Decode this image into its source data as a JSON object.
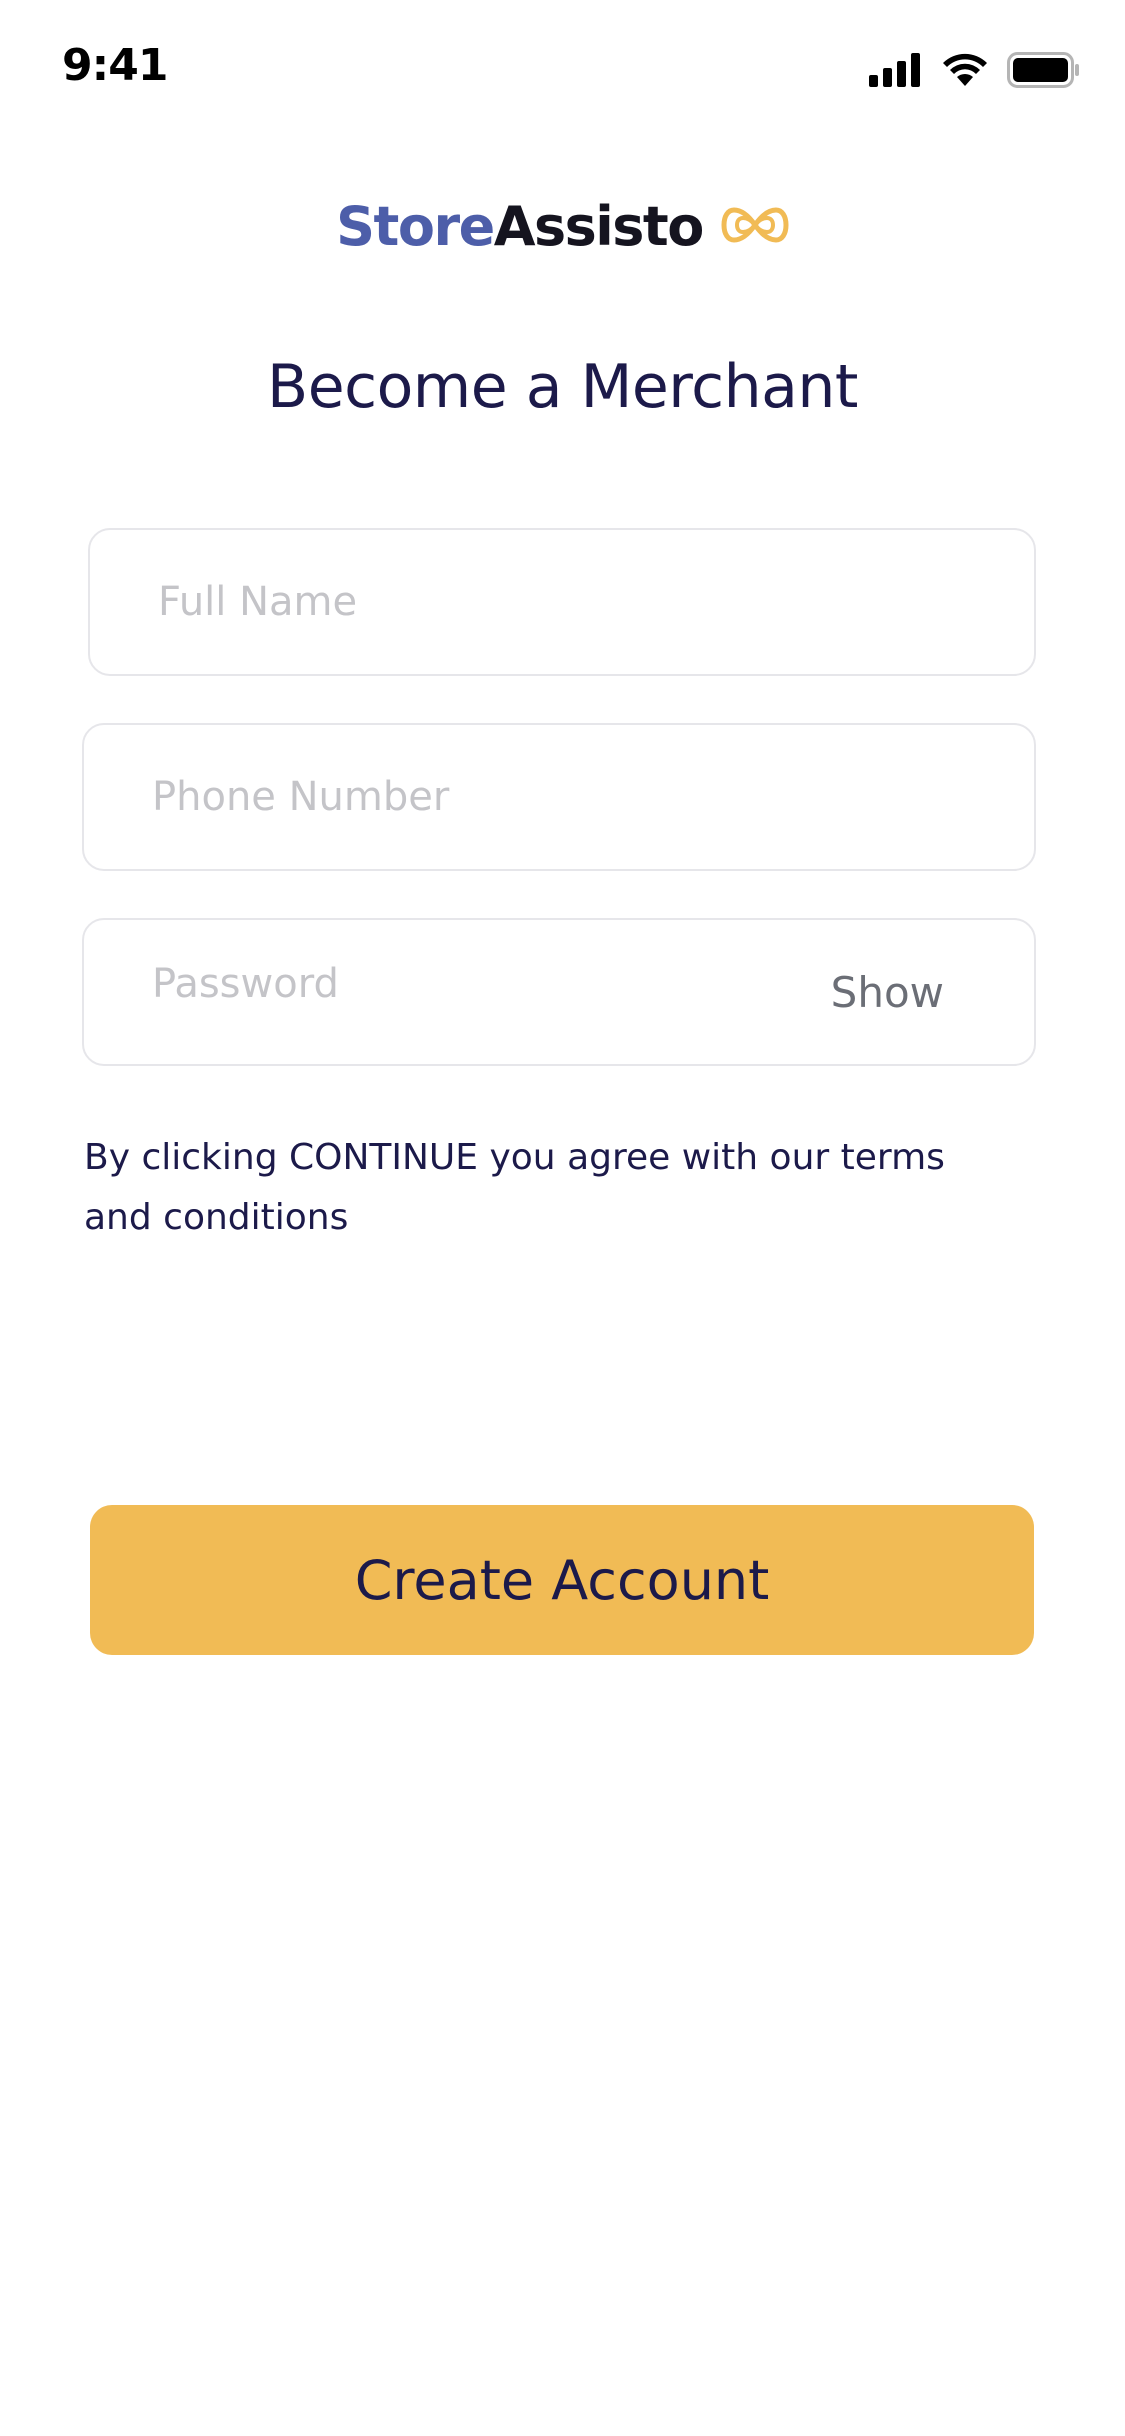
{
  "status_bar": {
    "time": "9:41",
    "icons": [
      "cellular-signal-icon",
      "wifi-icon",
      "battery-icon"
    ]
  },
  "brand": {
    "part1": "Store",
    "part2": "Assisto",
    "icon": "infinity-icon",
    "colors": {
      "store": "#4d5ea9",
      "assisto": "#15141f",
      "icon": "#f1bb55"
    }
  },
  "page": {
    "title": "Become a Merchant"
  },
  "form": {
    "full_name": {
      "value": "",
      "placeholder": "Full Name"
    },
    "phone": {
      "value": "",
      "placeholder": "Phone Number"
    },
    "password": {
      "value": "",
      "placeholder": "Password",
      "toggle_label": "Show"
    },
    "terms_text": "By clicking CONTINUE you agree with our terms and conditions",
    "submit_label": "Create Account"
  },
  "colors": {
    "accent": "#f1bb55",
    "text_primary": "#1c1a4a",
    "placeholder": "#c4c4c8",
    "field_border": "#e6e6ea"
  }
}
